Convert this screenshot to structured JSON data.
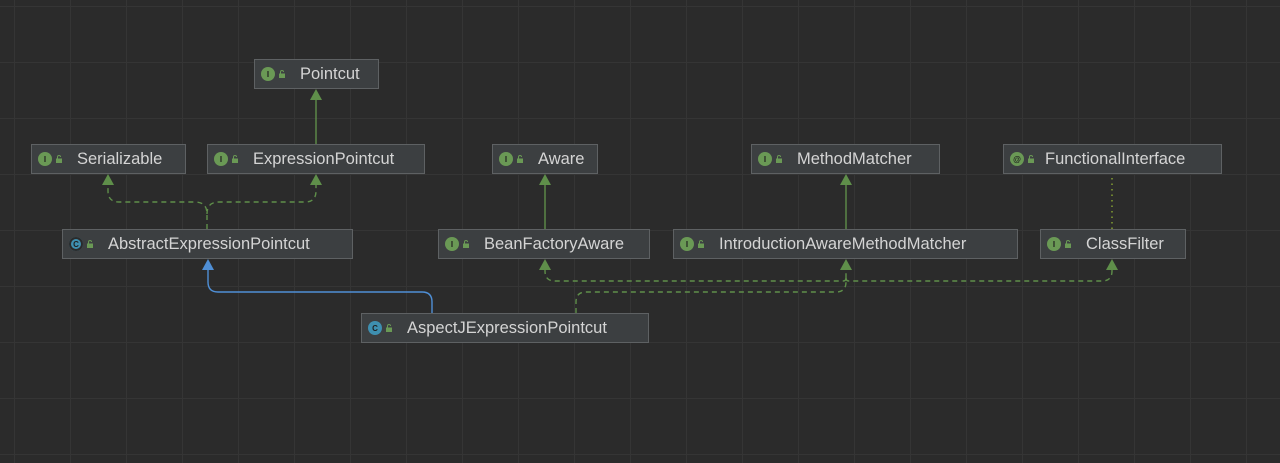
{
  "colors": {
    "interface": "#6a9955",
    "class": "#3e8fb0",
    "implements_edge": "#5f8f4a",
    "extends_edge": "#4f8fd6",
    "annotation_edge": "#8aa834"
  },
  "nodes": [
    {
      "id": "pointcut",
      "label": "Pointcut",
      "kind": "interface",
      "badge": "I",
      "icon": "interface-icon"
    },
    {
      "id": "serializable",
      "label": "Serializable",
      "kind": "interface",
      "badge": "I",
      "icon": "interface-icon"
    },
    {
      "id": "expression_pointcut",
      "label": "ExpressionPointcut",
      "kind": "interface",
      "badge": "I",
      "icon": "interface-icon"
    },
    {
      "id": "aware",
      "label": "Aware",
      "kind": "interface",
      "badge": "I",
      "icon": "interface-icon"
    },
    {
      "id": "method_matcher",
      "label": "MethodMatcher",
      "kind": "interface",
      "badge": "I",
      "icon": "interface-icon"
    },
    {
      "id": "functional_interface",
      "label": "FunctionalInterface",
      "kind": "annotation",
      "badge": "@",
      "icon": "annotation-icon"
    },
    {
      "id": "abstract_expression_pointcut",
      "label": "AbstractExpressionPointcut",
      "kind": "abstract",
      "badge": "C",
      "icon": "abstract-class-icon"
    },
    {
      "id": "bean_factory_aware",
      "label": "BeanFactoryAware",
      "kind": "interface",
      "badge": "I",
      "icon": "interface-icon"
    },
    {
      "id": "introduction_aware_method_matcher",
      "label": "IntroductionAwareMethodMatcher",
      "kind": "interface",
      "badge": "I",
      "icon": "interface-icon"
    },
    {
      "id": "class_filter",
      "label": "ClassFilter",
      "kind": "interface",
      "badge": "I",
      "icon": "interface-icon"
    },
    {
      "id": "aspectj_expression_pointcut",
      "label": "AspectJExpressionPointcut",
      "kind": "class",
      "badge": "C",
      "icon": "class-icon"
    }
  ],
  "edges": [
    {
      "from": "expression_pointcut",
      "to": "pointcut",
      "type": "extends-interface"
    },
    {
      "from": "abstract_expression_pointcut",
      "to": "serializable",
      "type": "implements"
    },
    {
      "from": "abstract_expression_pointcut",
      "to": "expression_pointcut",
      "type": "implements"
    },
    {
      "from": "bean_factory_aware",
      "to": "aware",
      "type": "extends-interface"
    },
    {
      "from": "introduction_aware_method_matcher",
      "to": "method_matcher",
      "type": "extends-interface"
    },
    {
      "from": "class_filter",
      "to": "functional_interface",
      "type": "annotated-by"
    },
    {
      "from": "aspectj_expression_pointcut",
      "to": "abstract_expression_pointcut",
      "type": "extends-class"
    },
    {
      "from": "aspectj_expression_pointcut",
      "to": "bean_factory_aware",
      "type": "implements"
    },
    {
      "from": "aspectj_expression_pointcut",
      "to": "introduction_aware_method_matcher",
      "type": "implements"
    },
    {
      "from": "aspectj_expression_pointcut",
      "to": "class_filter",
      "type": "implements"
    }
  ]
}
